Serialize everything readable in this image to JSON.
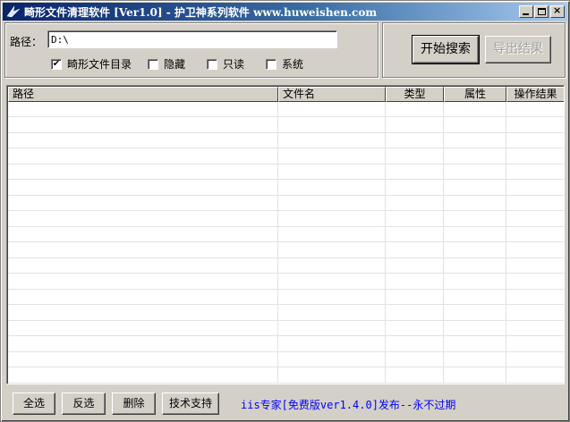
{
  "window": {
    "title": "畸形文件清理软件 [Ver1.0] - 护卫神系列软件 www.huweishen.com",
    "minimize_label": "_",
    "maximize_label": "□",
    "close_label": "×"
  },
  "search": {
    "path_label": "路径：",
    "path_value": "D:\\"
  },
  "options": [
    {
      "label": "畸形文件目录",
      "checked": true
    },
    {
      "label": "隐藏",
      "checked": false
    },
    {
      "label": "只读",
      "checked": false
    },
    {
      "label": "系统",
      "checked": false
    }
  ],
  "actions": {
    "search_label": "开始搜索",
    "export_label": "导出结果"
  },
  "table": {
    "columns": [
      "路径",
      "文件名",
      "类型",
      "属性",
      "操作结果"
    ],
    "rows": []
  },
  "footer": {
    "buttons": [
      "全选",
      "反选",
      "删除",
      "技术支持"
    ],
    "promo_text": "iis专家[免费版ver1.4.0]发布--永不过期"
  },
  "colors": {
    "title_gradient_start": "#0a246a",
    "title_gradient_end": "#a6caf0",
    "face": "#d4d0c8",
    "link": "#0000ff"
  }
}
